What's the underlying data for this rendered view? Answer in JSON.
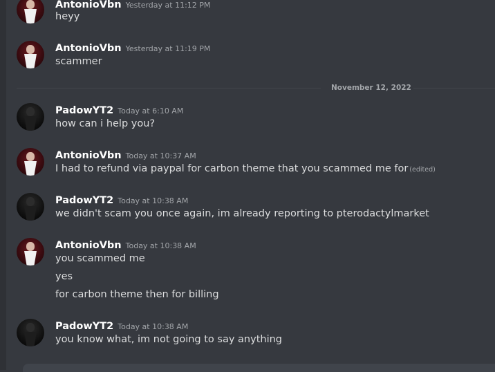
{
  "messages": [
    {
      "author": "AntonioVbn",
      "time": "Yesterday at 11:12 PM",
      "lines": [
        "heyy"
      ]
    },
    {
      "author": "AntonioVbn",
      "time": "Yesterday at 11:19 PM",
      "lines": [
        "scammer"
      ]
    },
    {
      "author": "PadowYT2",
      "time": "Today at 6:10 AM",
      "lines": [
        "how can i help you?"
      ]
    },
    {
      "author": "AntonioVbn",
      "time": "Today at 10:37 AM",
      "lines": [
        "I had to refund via paypal for carbon theme that you scammed me for"
      ],
      "edited": "(edited)"
    },
    {
      "author": "PadowYT2",
      "time": "Today at 10:38 AM",
      "lines": [
        "we didn't scam you once again, im already reporting to pterodactylmarket"
      ]
    },
    {
      "author": "AntonioVbn",
      "time": "Today at 10:38 AM",
      "lines": [
        "you scammed me",
        "yes",
        "for carbon theme then for billing"
      ]
    },
    {
      "author": "PadowYT2",
      "time": "Today at 10:38 AM",
      "lines": [
        "you know what, im not going to say anything"
      ]
    }
  ],
  "divider": {
    "label": "November 12, 2022"
  }
}
